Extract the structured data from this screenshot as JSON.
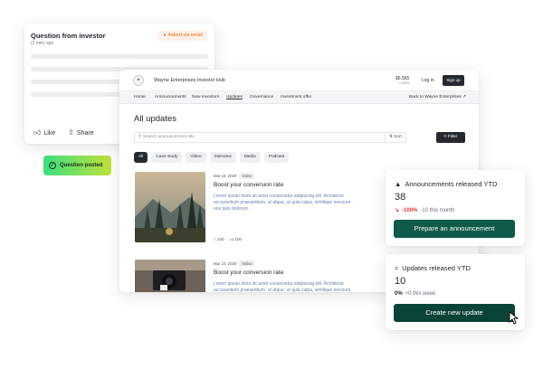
{
  "question_card": {
    "title": "Question from investor",
    "time": "(2 min) ago",
    "badge": "Asked via email",
    "like_label": "Like",
    "share_label": "Share"
  },
  "toast": {
    "label": "Question posted"
  },
  "hub": {
    "name": "Wayne Enterprises Investor Hub",
    "price": "$6.565",
    "price_change": "+ 1.58%",
    "login_label": "Log in",
    "signup_label": "Sign up",
    "nav": [
      "Home",
      "Announcements",
      "New investors",
      "Updates",
      "Governance",
      "Investment offer"
    ],
    "nav_active": "Updates",
    "back_link": "Back to Wayne Enterprises",
    "page_title": "All updates",
    "search_placeholder": "Search announcement title",
    "sort_label": "Sort",
    "filter_label": "Filter",
    "chips": [
      "All",
      "Case study",
      "Video",
      "Interview",
      "Media",
      "Podcast"
    ],
    "posts": [
      {
        "date": "Mar 10, 2020",
        "tag": "Video",
        "title": "Boost your conversion rate",
        "description": "Lorem ipsum dolor sit amet consectetur adipiscing elit. Architecto accusantium praesentium, ut atque, ut quia culpa, similique nesciunt eos quis dolorum.",
        "comments": "100",
        "likes": "100"
      },
      {
        "date": "Mar 10, 2020",
        "tag": "Video",
        "title": "Boost your conversion rate",
        "description": "Lorem ipsum dolor sit amet consectetur adipiscing elit. Architecto accusantium praesentium, ut atque, ut quia culpa, similique nesciunt eos quis dolorum."
      }
    ]
  },
  "stats": {
    "announcements": {
      "label": "Announcements released YTD",
      "value": "38",
      "change": "-100%",
      "change_note": "-10 this month",
      "cta": "Prepare an announcement"
    },
    "updates": {
      "label": "Updates released YTD",
      "value": "10",
      "change": "0%",
      "change_note": "+0 this week",
      "cta": "Create new update"
    }
  },
  "colors": {
    "accent_dark_green": "#0f5a48",
    "negative": "#d93b3b",
    "badge_orange": "#d9731f",
    "toast_gradient_start": "#3be07f",
    "toast_gradient_end": "#bfe13a"
  }
}
